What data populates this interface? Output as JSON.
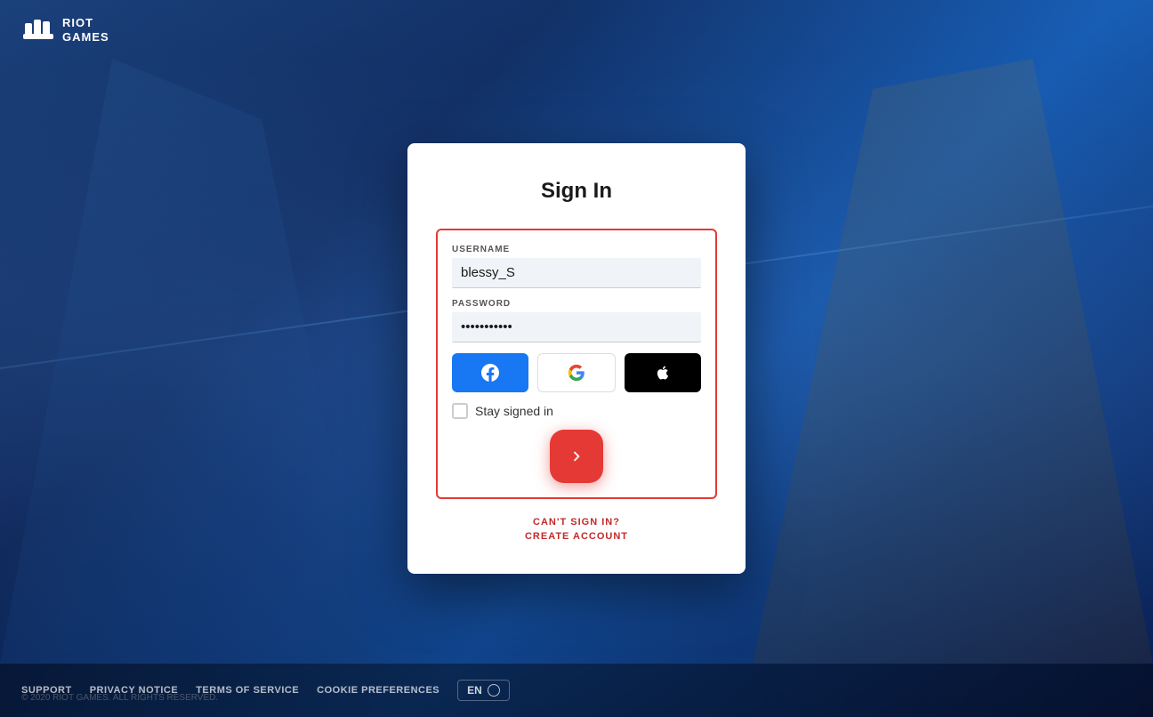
{
  "logo": {
    "title": "RIOT\nGAMES",
    "line1": "RIOT",
    "line2": "GAMES"
  },
  "signin": {
    "title": "Sign In",
    "username_label": "USERNAME",
    "username_value": "blessy_S",
    "password_label": "PASSWORD",
    "password_value": "••••••••••••",
    "stay_signed_label": "Stay signed in",
    "cant_signin": "CAN'T SIGN IN?",
    "create_account": "CREATE ACCOUNT"
  },
  "sso": {
    "facebook_icon": "f",
    "google_icon": "G",
    "apple_icon": ""
  },
  "footer": {
    "links": [
      "SUPPORT",
      "PRIVACY NOTICE",
      "TERMS OF SERVICE",
      "COOKIE PREFERENCES"
    ],
    "lang": "EN",
    "copyright": "© 2020 RIOT GAMES. ALL RIGHTS RESERVED."
  }
}
